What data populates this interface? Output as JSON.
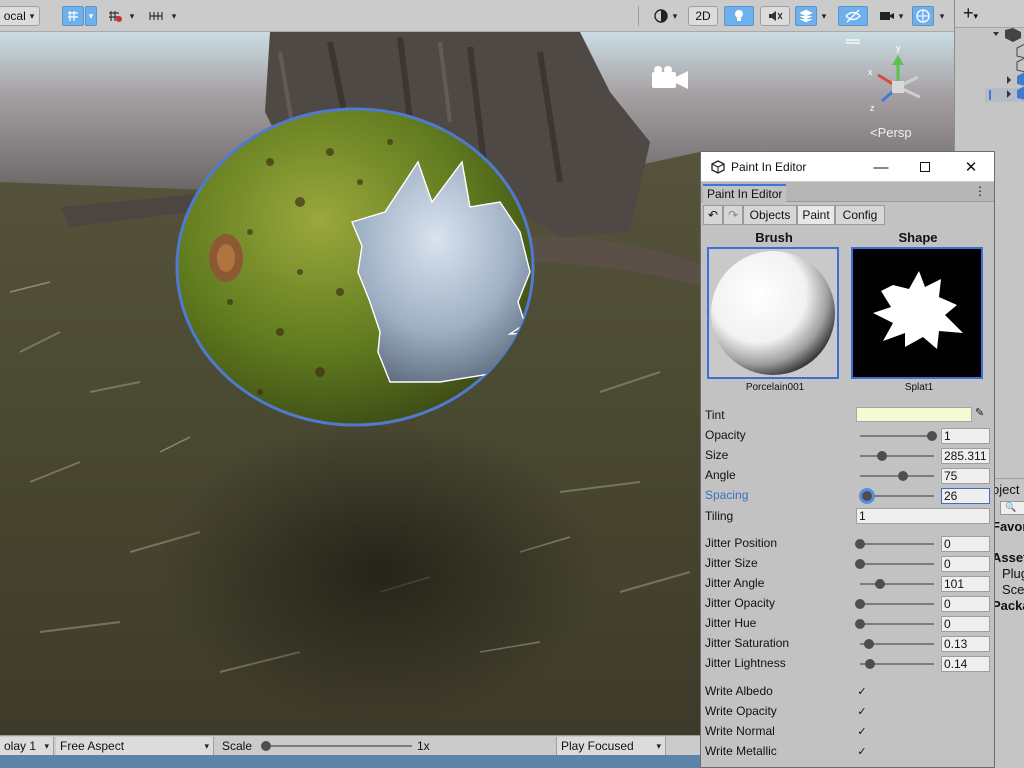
{
  "toolbar": {
    "pivot_label": "ocal",
    "gizmos_2d_label": "2D",
    "persp_label": "<Persp"
  },
  "gamebar": {
    "display_label": "olay 1",
    "aspect_label": "Free Aspect",
    "scale_label": "Scale",
    "scale_value": "1x",
    "play_mode_label": "Play Focused"
  },
  "project": {
    "obj_label": "oject",
    "favorites_label": "Favor",
    "assets_label": "Asset",
    "plugins_label": "Plug",
    "scenes_label": "Scen",
    "packages_label": "Packa"
  },
  "window": {
    "title": "Paint In Editor",
    "tab_label": "Paint In Editor",
    "subtabs": [
      "Objects",
      "Paint",
      "Config"
    ],
    "active_subtab": "Paint",
    "brush_header": "Brush",
    "shape_header": "Shape",
    "brush_name": "Porcelain001",
    "shape_name": "Splat1",
    "tint_label": "Tint",
    "tint_color": "#f4fbd2",
    "tiling_label": "Tiling",
    "tiling_value": "1",
    "sliders": [
      {
        "label": "Opacity",
        "value": "1",
        "fraction": 1.0
      },
      {
        "label": "Size",
        "value": "285.311",
        "fraction": 0.3
      },
      {
        "label": "Angle",
        "value": "75",
        "fraction": 0.6
      },
      {
        "label": "Spacing",
        "value": "26",
        "fraction": 0.1,
        "active": true
      },
      {
        "label": "Jitter Position",
        "value": "0",
        "fraction": 0.0
      },
      {
        "label": "Jitter Size",
        "value": "0",
        "fraction": 0.0
      },
      {
        "label": "Jitter Angle",
        "value": "101",
        "fraction": 0.28
      },
      {
        "label": "Jitter Opacity",
        "value": "0",
        "fraction": 0.0
      },
      {
        "label": "Jitter Hue",
        "value": "0",
        "fraction": 0.0
      },
      {
        "label": "Jitter Saturation",
        "value": "0.13",
        "fraction": 0.13
      },
      {
        "label": "Jitter Lightness",
        "value": "0.14",
        "fraction": 0.14
      }
    ],
    "checkboxes": [
      {
        "label": "Write Albedo",
        "checked": true
      },
      {
        "label": "Write Opacity",
        "checked": true
      },
      {
        "label": "Write Normal",
        "checked": true
      },
      {
        "label": "Write Metallic",
        "checked": true
      }
    ]
  },
  "colors": {
    "accent": "#3a6fc8",
    "toolbar_active": "#6eb0ec"
  }
}
